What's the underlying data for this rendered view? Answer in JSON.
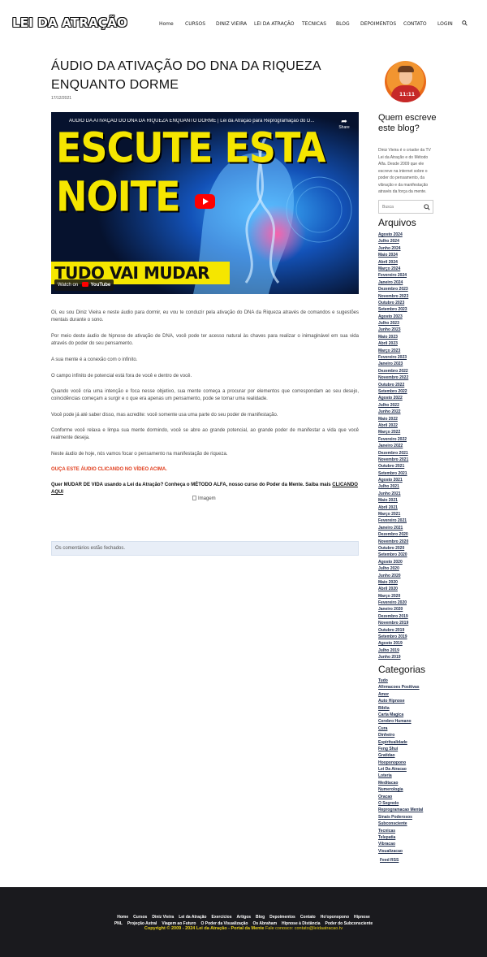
{
  "site": {
    "logo": "LEI DA ATRAÇÃO",
    "nav": [
      "Home",
      "CURSOS",
      "DINIZ VIEIRA",
      "LEI DA ATRAÇÃO",
      "TECNICAS",
      "BLOG",
      "DEPOIMENTOS",
      "CONTATO",
      "LOGIN"
    ]
  },
  "post": {
    "title": "ÁUDIO DA ATIVAÇÃO DO DNA DA RIQUEZA ENQUANTO DORME",
    "date": "17/12/2021",
    "video": {
      "title": "ÁUDIO DA ATIVAÇÃO DO DNA DA RIQUEZA ENQUANTO DORME | Lei da Atração para Reprogramação do D...",
      "thumb_line1": "ESCUTE ESTA",
      "thumb_line2": "NOITE",
      "thumb_line3": "TUDO VAI MUDAR",
      "watch_on": "Watch on",
      "youtube": "YouTube",
      "share": "Share"
    },
    "paragraphs": [
      "Oi, eu sou Diniz Vieira e neste áudio para dormir, eu vou te conduzir pela ativação do DNA da Riqueza através de comandos e sugestões mentais durante o sono.",
      "Por meio deste áudio de hipnose de ativação de DNA, você pode ter acesso natural às chaves para realizar o inimaginável em sua vida através do poder do seu pensamento.",
      "A sua mente é a conexão com o infinito.",
      "O campo infinito de potencial está fora de você e dentro de você.",
      "Quando você cria uma intenção e foca nesse objetivo, sua mente começa a procurar por elementos que correspondam ao seu desejo, coincidências começam a surgir e o que era apenas um pensamento, pode se tornar uma realidade.",
      "Você pode já até saber disso, mas acredite: você somente usa uma parte do seu poder de manifestação.",
      "Conforme você relaxa e limpa sua mente dormindo, você se abre ao grande potencial, ao grande poder de manifestar a vida que você realmente deseja.",
      "Neste áudio de hoje, nós vamos focar o pensamento na manifestação de riqueza."
    ],
    "cta_red": "OUÇA ESTE ÁUDIO CLICANDO NO VÍDEO ACIMA.",
    "cta_bold": "Quer MUDAR DE VIDA usando a Lei da Atração? Conheça o MÉTODO ALFA, nosso curso do Poder da Mente. Saiba mais",
    "cta_link": "CLICANDO AQUI",
    "image_alt": "Imagem",
    "comments_closed": "Os comentários estão fechados."
  },
  "sidebar": {
    "avatar_text": "11:11",
    "about_heading": "Quem escreve este blog?",
    "about_text": "Diniz Vieira é o criador da TV Lei da Atração e do Método Alfa. Desde 2009 que ele escreve na internet sobre o poder do pensamento, da vibração e da manifestação através da força da mente.",
    "search_placeholder": "Busca",
    "archives_heading": "Arquivos",
    "archives": [
      "Agosto 2024",
      "Julho 2024",
      "Junho 2024",
      "Maio 2024",
      "Abril 2024",
      "Março 2024",
      "Fevereiro 2024",
      "Janeiro 2024",
      "Dezembro 2023",
      "Novembro 2023",
      "Outubro 2023",
      "Setembro 2023",
      "Agosto 2023",
      "Julho 2023",
      "Junho 2023",
      "Maio 2023",
      "Abril 2023",
      "Março 2023",
      "Fevereiro 2023",
      "Janeiro 2023",
      "Dezembro 2022",
      "Novembro 2022",
      "Outubro 2022",
      "Setembro 2022",
      "Agosto 2022",
      "Julho 2022",
      "Junho 2022",
      "Maio 2022",
      "Abril 2022",
      "Março 2022",
      "Fevereiro 2022",
      "Janeiro 2022",
      "Dezembro 2021",
      "Novembro 2021",
      "Outubro 2021",
      "Setembro 2021",
      "Agosto 2021",
      "Julho 2021",
      "Junho 2021",
      "Maio 2021",
      "Abril 2021",
      "Março 2021",
      "Fevereiro 2021",
      "Janeiro 2021",
      "Dezembro 2020",
      "Novembro 2020",
      "Outubro 2020",
      "Setembro 2020",
      "Agosto 2020",
      "Julho 2020",
      "Junho 2020",
      "Maio 2020",
      "Abril 2020",
      "Março 2020",
      "Fevereiro 2020",
      "Janeiro 2020",
      "Dezembro 2019",
      "Novembro 2019",
      "Outubro 2019",
      "Setembro 2019",
      "Agosto 2019",
      "Julho 2019",
      "Junho 2019"
    ],
    "categories_heading": "Categorias",
    "categories": [
      "Tudo",
      "Afirmacoes Positivas",
      "Amor",
      "Auto Hipnose",
      "Biblia",
      "Carta Magica",
      "Cerebro Humano",
      "Cura",
      "Dinheiro",
      "Espiritualidade",
      "Feng Shui",
      "Gratidao",
      "Hooponopono",
      "Lei Da Atracao",
      "Loteria",
      "Meditacao",
      "Numerologia",
      "Oracao",
      "O Segredo",
      "Reprogramacao Mental",
      "Sinais Poderosos",
      "Subconsciente",
      "Tecnicas",
      "Telepatia",
      "Vibracao",
      "Visualizacao"
    ],
    "feed": "Feed RSS"
  },
  "footer": {
    "row1": [
      "Home",
      "Cursos",
      "Diniz Vieira",
      "Lei da Atração",
      "Exercícios",
      "Artigos",
      "Blog",
      "Depoimentos",
      "Contato",
      "Ho'oponopono",
      "Hipnose"
    ],
    "row2": [
      "PNL",
      "Projeção Astral",
      "Viagem ao Futuro",
      "O Poder da Visualização",
      "Os Abraham",
      "Hipnose à Distância",
      "Poder do Subconsciente"
    ],
    "copyright": "Copyright © 2009 - 2024 Lei da Atração - Portal da Mente",
    "contact": "Fale conosco: contato@leidaatracao.tv"
  }
}
